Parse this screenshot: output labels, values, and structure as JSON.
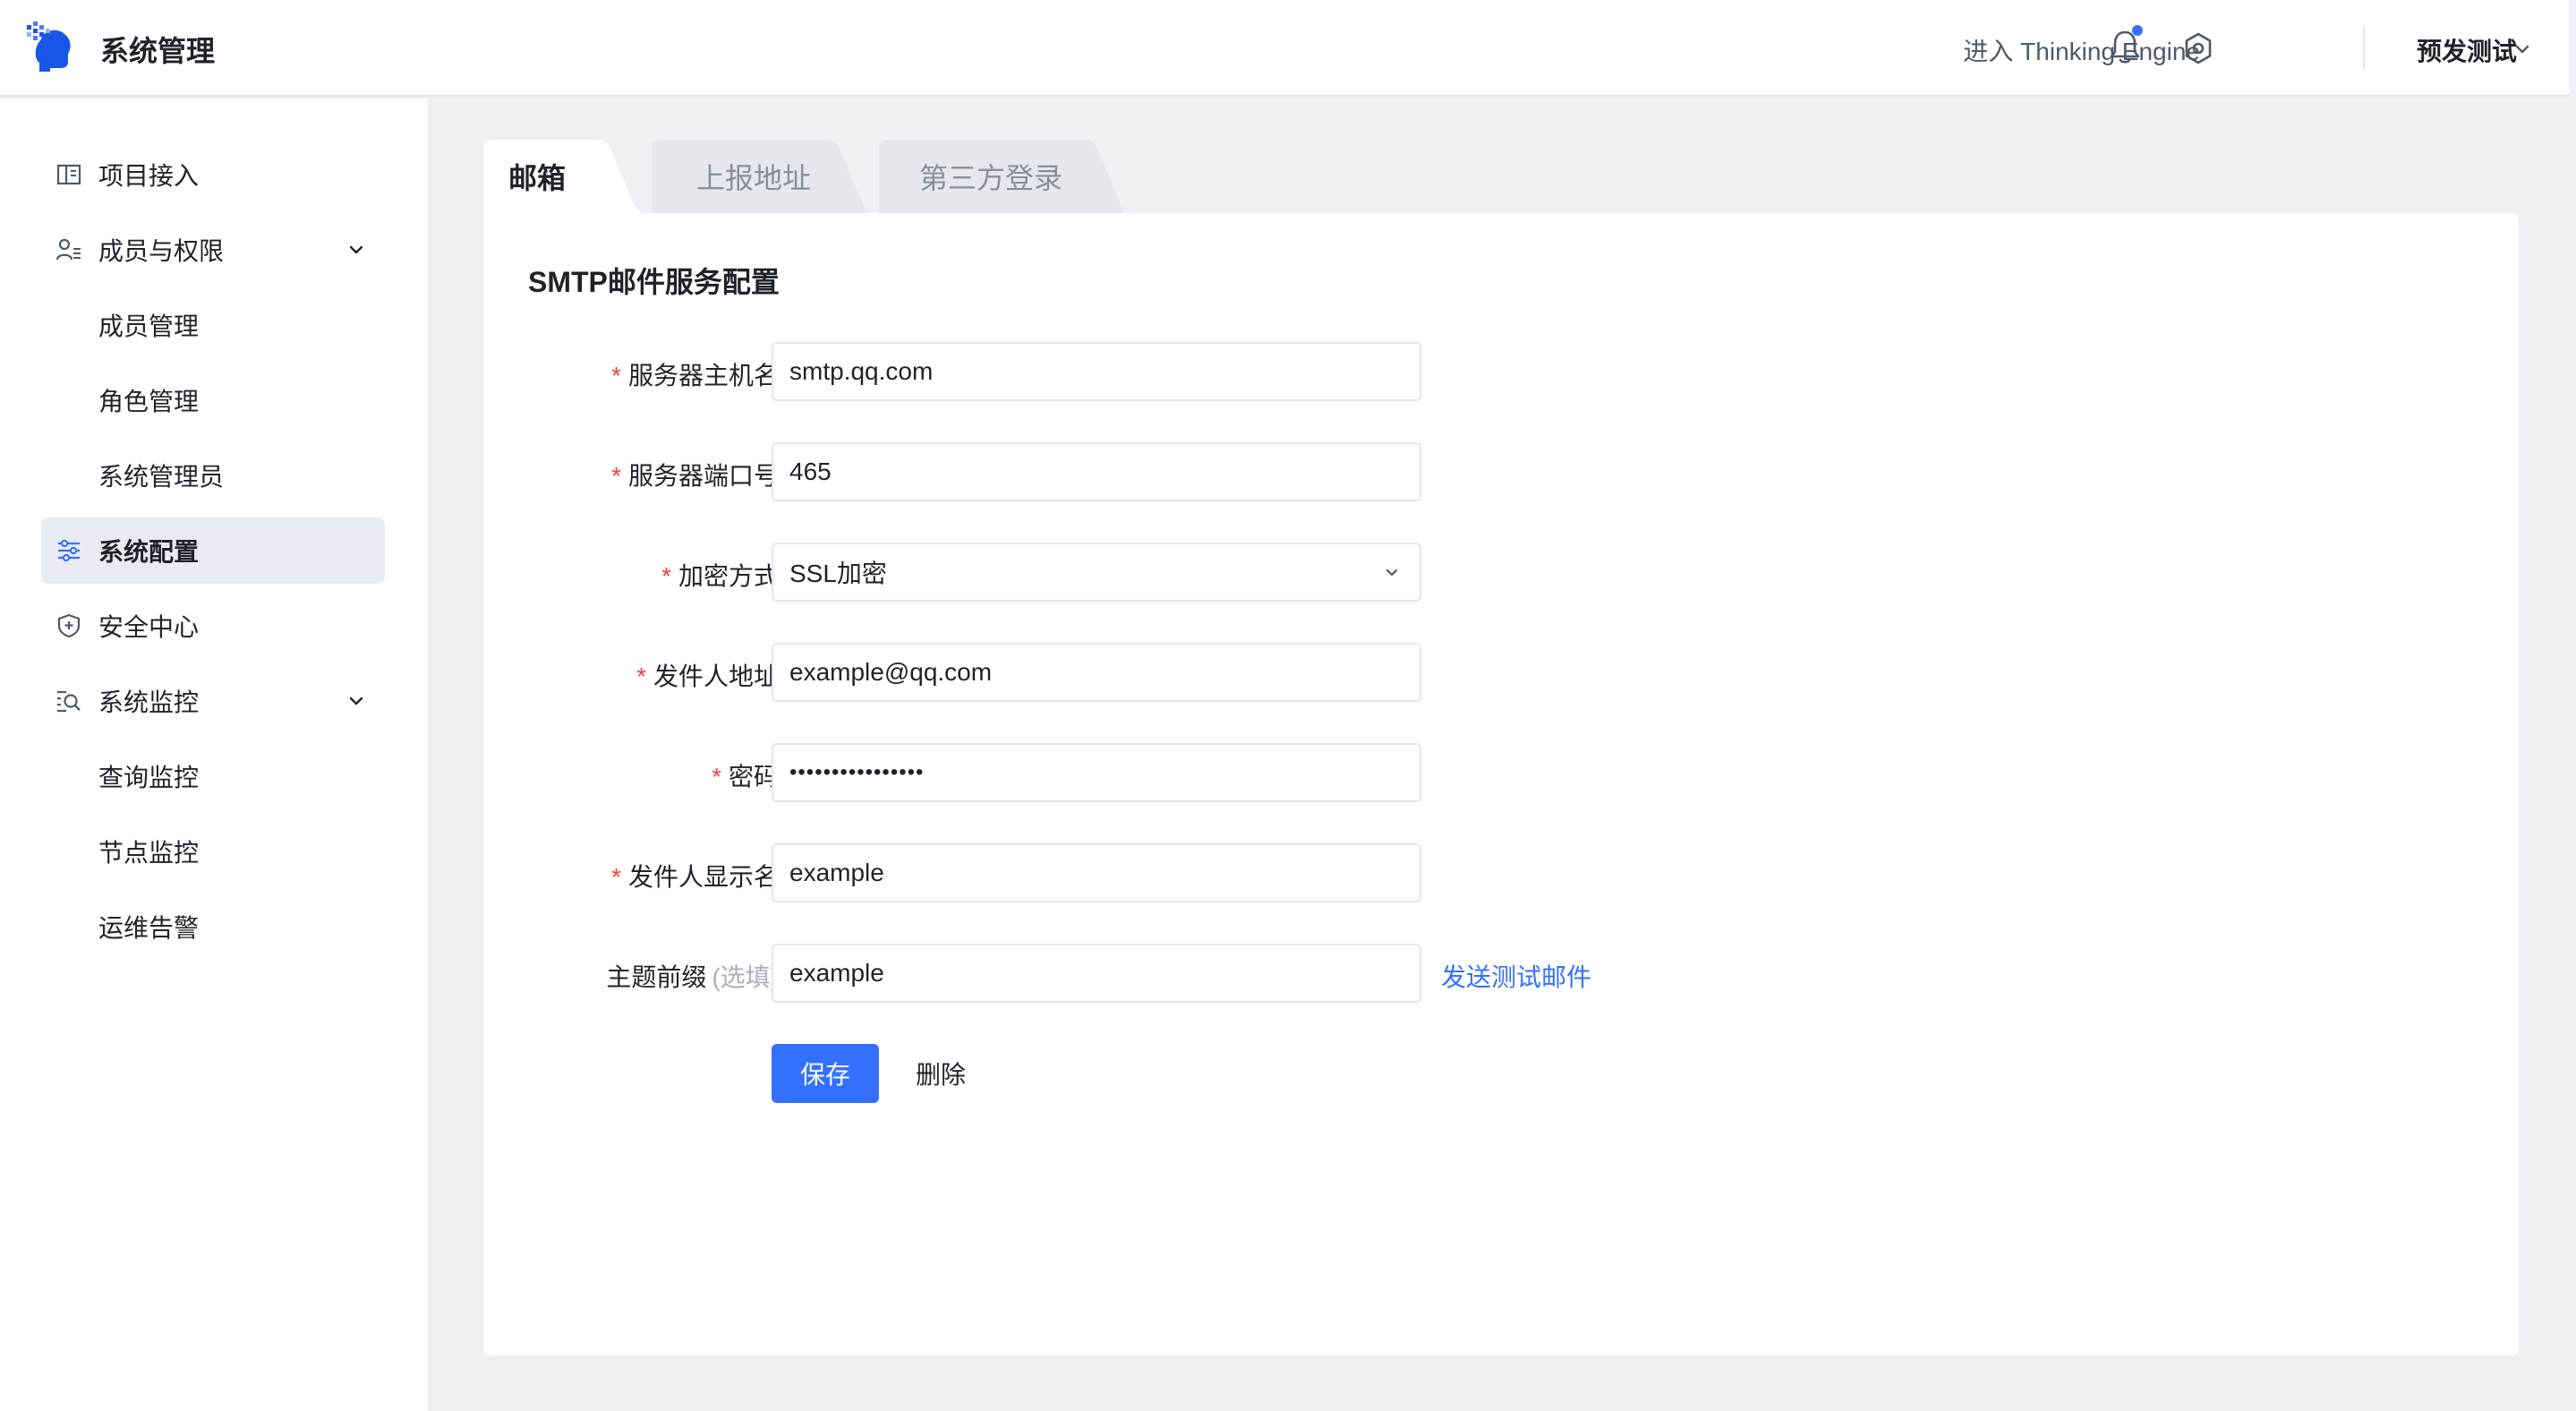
{
  "header": {
    "app_title": "系统管理",
    "enter_label": "进入 Thinking Engine",
    "environment": "预发测试"
  },
  "sidebar": {
    "items": [
      {
        "label": "项目接入",
        "icon": "project-icon"
      },
      {
        "label": "成员与权限",
        "icon": "members-icon",
        "expanded": true
      },
      {
        "label": "成员管理"
      },
      {
        "label": "角色管理"
      },
      {
        "label": "系统管理员"
      },
      {
        "label": "系统配置",
        "icon": "settings-sliders-icon",
        "active": true
      },
      {
        "label": "安全中心",
        "icon": "shield-icon"
      },
      {
        "label": "系统监控",
        "icon": "monitor-search-icon",
        "expanded": true
      },
      {
        "label": "查询监控"
      },
      {
        "label": "节点监控"
      },
      {
        "label": "运维告警"
      }
    ]
  },
  "tabs": [
    {
      "label": "邮箱",
      "active": true
    },
    {
      "label": "上报地址"
    },
    {
      "label": "第三方登录"
    }
  ],
  "form": {
    "title": "SMTP邮件服务配置",
    "fields": [
      {
        "label": "服务器主机名",
        "required": true,
        "value": "smtp.qq.com"
      },
      {
        "label": "服务器端口号",
        "required": true,
        "value": "465"
      },
      {
        "label": "加密方式",
        "required": true,
        "value": "SSL加密"
      },
      {
        "label": "发件人地址",
        "required": true,
        "value": "example@qq.com"
      },
      {
        "label": "密码",
        "required": true,
        "value": "••••••••••••••••"
      },
      {
        "label": "发件人显示名",
        "required": true,
        "value": "example"
      },
      {
        "label": "主题前缀",
        "optional_hint": "(选填)",
        "value": "example"
      }
    ],
    "send_test_label": "发送测试邮件",
    "save_label": "保存",
    "delete_label": "删除"
  },
  "colors": {
    "accent": "#3370ff",
    "required": "#f53f3f",
    "active_nav_bg": "#e8ebf2",
    "page_bg": "#eef0f4"
  }
}
